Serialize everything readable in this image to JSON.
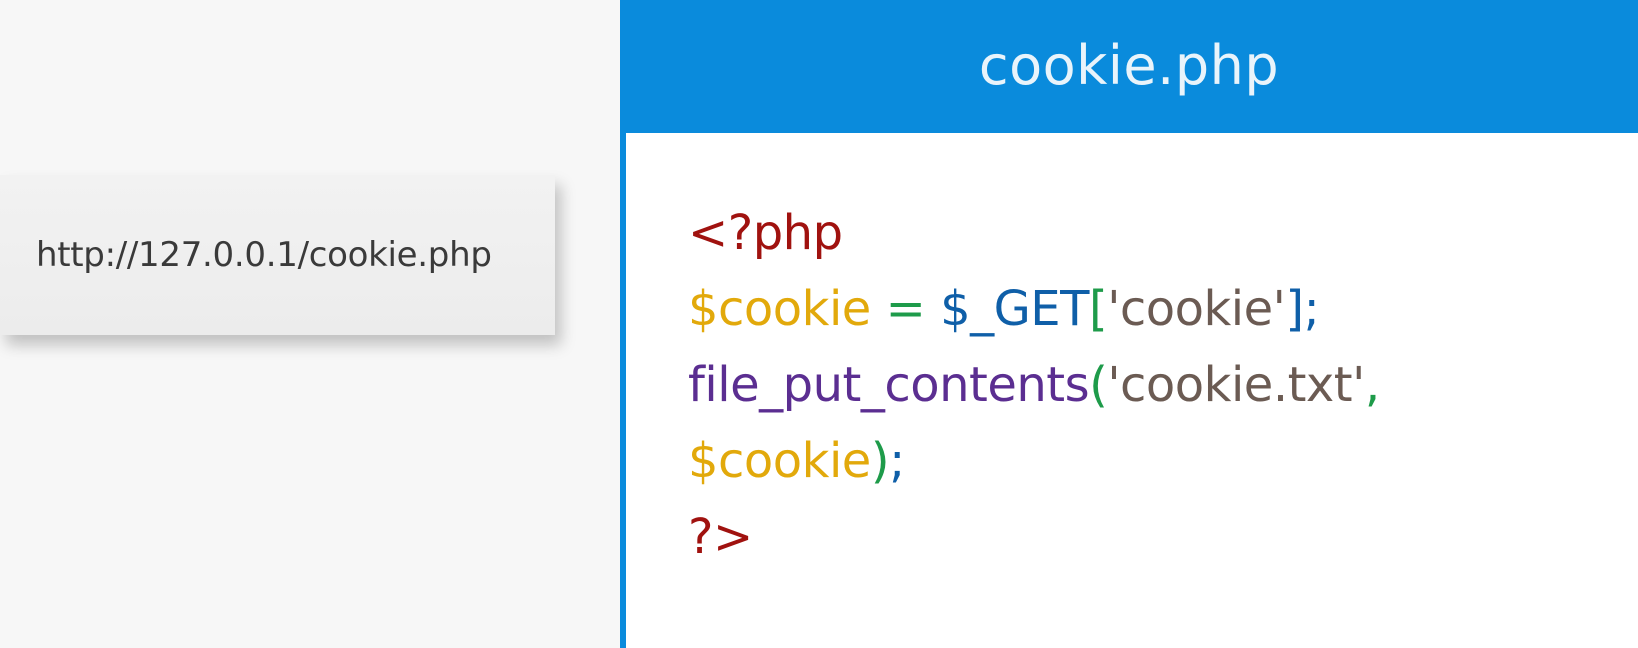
{
  "url_bar": {
    "text": "http://127.0.0.1/cookie.php"
  },
  "file": {
    "title": "cookie.php"
  },
  "code_lines": [
    [
      {
        "text": "<?php",
        "color": "#a0120f"
      }
    ],
    [
      {
        "text": "$cookie",
        "color": "#e2a90b"
      },
      {
        "text": " = ",
        "color": "#1e9b4a"
      },
      {
        "text": "$_GET",
        "color": "#0f5fa8"
      },
      {
        "text": "[",
        "color": "#1e9b4a"
      },
      {
        "text": "'cookie'",
        "color": "#6b5b53"
      },
      {
        "text": "];",
        "color": "#0f5fa8"
      }
    ],
    [
      {
        "text": "file_put_contents",
        "color": "#5b2e91"
      },
      {
        "text": "(",
        "color": "#1e9b4a"
      },
      {
        "text": "'cookie.txt'",
        "color": "#6b5b53"
      },
      {
        "text": ",",
        "color": "#1e9b4a"
      }
    ],
    [
      {
        "text": "$cookie",
        "color": "#e2a90b"
      },
      {
        "text": ")",
        "color": "#1e9b4a"
      },
      {
        "text": ";",
        "color": "#0f5fa8"
      }
    ],
    [
      {
        "text": "?>",
        "color": "#a0120f"
      }
    ]
  ]
}
